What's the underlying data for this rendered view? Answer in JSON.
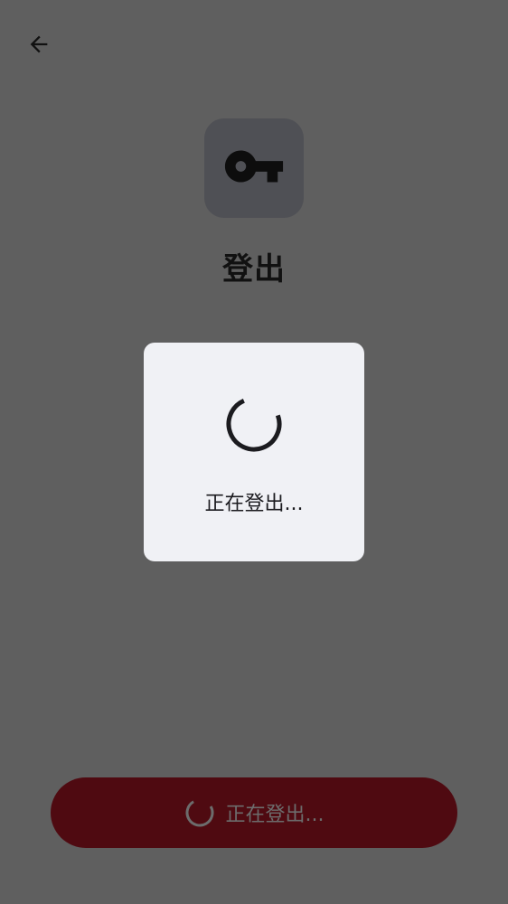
{
  "header": {
    "back_icon": "arrow-left-icon",
    "title": "登出",
    "app_icon": "key-icon"
  },
  "dialog": {
    "message": "正在登出...",
    "spinner": "loading-spinner-icon"
  },
  "footer": {
    "button_label": "正在登出...",
    "spinner": "loading-spinner-icon"
  },
  "colors": {
    "overlay_background": "#5f5f5f",
    "tile_background": "#4f5055",
    "dialog_background": "#f0f1f5",
    "button_background": "#4f0a11",
    "button_text": "#6c6c6c"
  }
}
